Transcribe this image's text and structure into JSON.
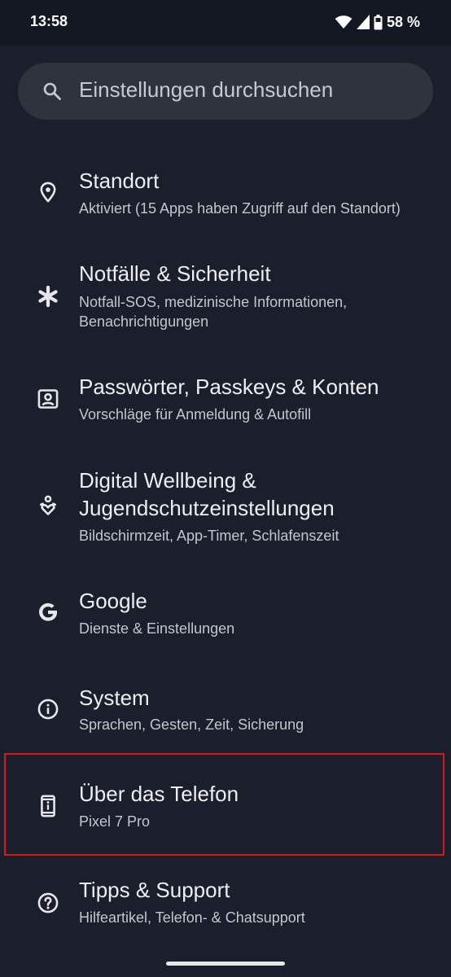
{
  "status_bar": {
    "time": "13:58",
    "battery": "58 %",
    "icons": [
      "wifi-icon",
      "signal-icon",
      "battery-icon"
    ]
  },
  "search": {
    "placeholder": "Einstellungen durchsuchen",
    "icon": "search-icon"
  },
  "settings": [
    {
      "title": "Standort",
      "subtitle": "Aktiviert (15 Apps haben Zugriff auf den Standort)",
      "icon": "location-pin-icon"
    },
    {
      "title": "Notfälle & Sicherheit",
      "subtitle_lines": [
        "Notfall-SOS, medizinische Informationen,",
        "Benachrichtigungen"
      ],
      "icon": "asterisk-icon"
    },
    {
      "title": "Passwörter, Passkeys & Konten",
      "subtitle": "Vorschläge für Anmeldung & Autofill",
      "icon": "account-box-icon"
    },
    {
      "title_lines": [
        "Digital Wellbeing &",
        "Jugendschutzeinstellungen"
      ],
      "subtitle": "Bildschirmzeit, App-Timer, Schlafenszeit",
      "icon": "wellbeing-icon"
    },
    {
      "title": "Google",
      "subtitle": "Dienste & Einstellungen",
      "icon": "google-g-icon"
    },
    {
      "title": "System",
      "subtitle": "Sprachen, Gesten, Zeit, Sicherung",
      "icon": "info-circle-icon"
    },
    {
      "title": "Über das Telefon",
      "subtitle": "Pixel 7 Pro",
      "icon": "phone-info-icon",
      "highlighted": true
    },
    {
      "title": "Tipps & Support",
      "subtitle": "Hilfeartikel, Telefon- & Chatsupport",
      "icon": "help-circle-icon"
    }
  ],
  "colors": {
    "background": "#1b1f2b",
    "status_bar": "#141822",
    "search_bg": "#2f333d",
    "highlight": "#e0121a"
  }
}
